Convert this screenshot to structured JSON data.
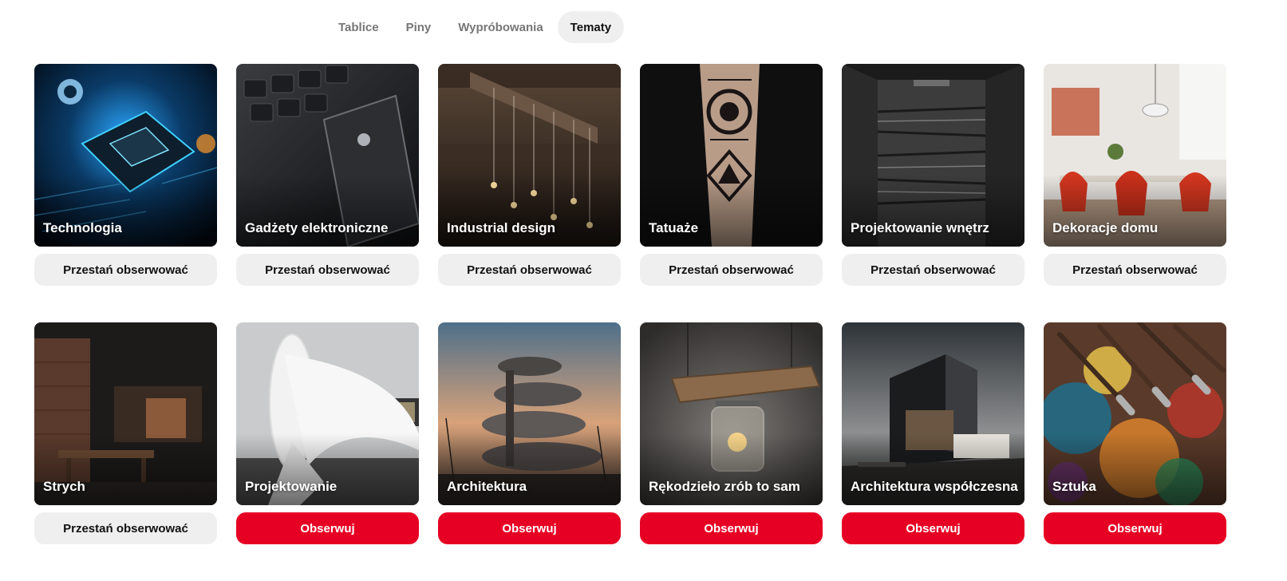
{
  "tabs": [
    {
      "label": "Tablice",
      "active": false
    },
    {
      "label": "Piny",
      "active": false
    },
    {
      "label": "Wypróbowania",
      "active": false
    },
    {
      "label": "Tematy",
      "active": true
    }
  ],
  "buttons": {
    "unfollow": "Przestań obserwować",
    "follow": "Obserwuj"
  },
  "colors": {
    "follow_red": "#e60023",
    "unfollow_gray": "#efefef",
    "active_tab": "#efefef"
  },
  "topics": [
    {
      "name": "Technologia",
      "following": true,
      "image": "circuit-board-robot-image"
    },
    {
      "name": "Gadżety elektroniczne",
      "following": true,
      "image": "smartphone-keyboard-image"
    },
    {
      "name": "Industrial design",
      "following": true,
      "image": "hanging-bulbs-beam-image"
    },
    {
      "name": "Tatuaże",
      "following": true,
      "image": "forearm-tattoo-image"
    },
    {
      "name": "Projektowanie wnętrz",
      "following": true,
      "image": "stone-shower-image"
    },
    {
      "name": "Dekoracje domu",
      "following": true,
      "image": "dining-room-red-chairs-image"
    },
    {
      "name": "Strych",
      "following": true,
      "image": "loft-kitchen-image"
    },
    {
      "name": "Projektowanie",
      "following": false,
      "image": "white-curved-interior-image"
    },
    {
      "name": "Architektura",
      "following": false,
      "image": "spiral-building-image"
    },
    {
      "name": "Rękodzieło zrób to sam",
      "following": false,
      "image": "wood-jar-lamp-image"
    },
    {
      "name": "Architektura współczesna",
      "following": false,
      "image": "modern-cube-house-image"
    },
    {
      "name": "Sztuka",
      "following": false,
      "image": "paint-brushes-palette-image"
    }
  ]
}
